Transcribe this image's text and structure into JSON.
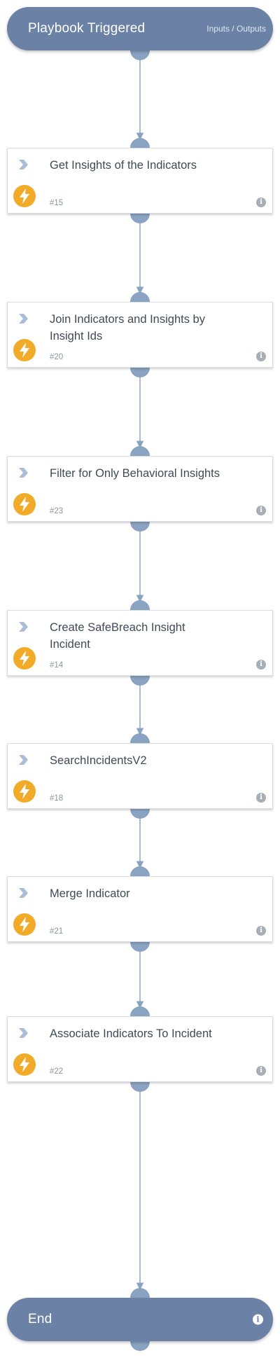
{
  "start": {
    "title": "Playbook Triggered",
    "links": "Inputs / Outputs"
  },
  "tasks": [
    {
      "name": "Get Insights of the Indicators",
      "number": "#15"
    },
    {
      "name": "Join Indicators and Insights by Insight Ids",
      "number": "#20"
    },
    {
      "name": "Filter for Only Behavioral Insights",
      "number": "#23"
    },
    {
      "name": "Create SafeBreach Insight Incident",
      "number": "#14"
    },
    {
      "name": "SearchIncidentsV2",
      "number": "#18"
    },
    {
      "name": "Merge Indicator",
      "number": "#21"
    },
    {
      "name": "Associate Indicators To Incident",
      "number": "#22"
    }
  ],
  "end": {
    "title": "End"
  },
  "colors": {
    "terminal_fill": "#6b82a6",
    "connector": "#8aa3c2",
    "bolt": "#f2ab28",
    "chevron": "#a9bdd6"
  },
  "icons": {
    "task_type": "chevron-right-icon",
    "automation": "lightning-bolt-icon",
    "details": "info-icon"
  }
}
